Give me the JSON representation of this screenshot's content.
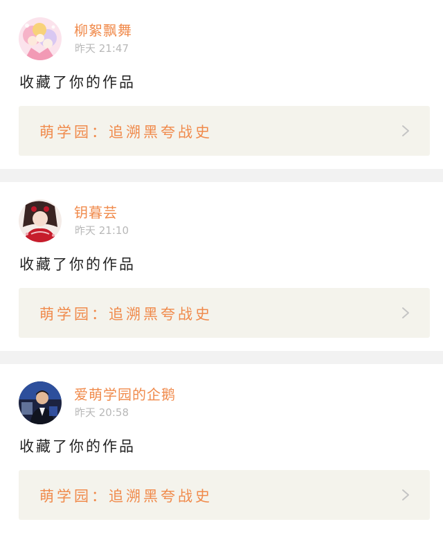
{
  "feed": {
    "items": [
      {
        "username": "柳絮飘舞",
        "time": "昨天 21:47",
        "action": "收藏了你的作品",
        "work_title": "萌学园：追溯黑夸战史",
        "avatar_icon": "anime-girls-avatar-icon"
      },
      {
        "username": "钥暮芸",
        "time": "昨天 21:10",
        "action": "收藏了你的作品",
        "work_title": "萌学园：追溯黑夸战史",
        "avatar_icon": "red-dress-girl-avatar-icon"
      },
      {
        "username": "爱萌学园的企鹅",
        "time": "昨天 20:58",
        "action": "收藏了你的作品",
        "work_title": "萌学园：追溯黑夸战史",
        "avatar_icon": "man-photo-avatar-icon"
      }
    ]
  },
  "colors": {
    "accent": "#f08a4b",
    "card_link_bg": "#f4f3ec",
    "separator": "#f2f2f2",
    "time_text": "#b8b8b8"
  }
}
